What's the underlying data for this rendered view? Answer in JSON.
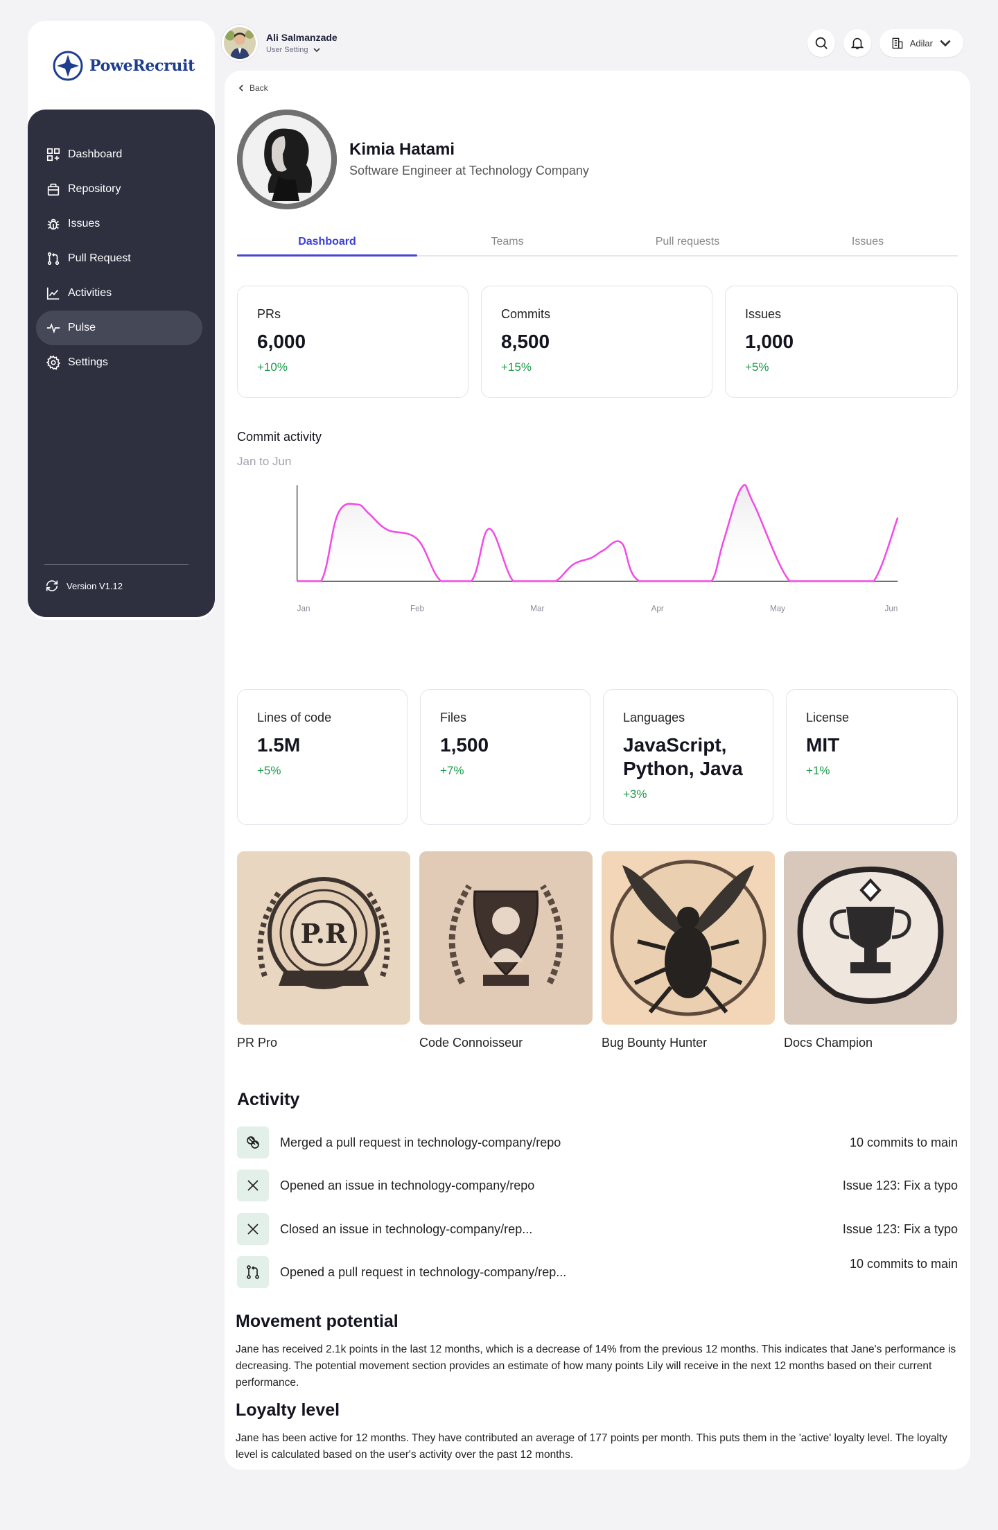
{
  "brand": {
    "name": "PoweRecruit",
    "color": "#1d3d8f"
  },
  "sidebar": {
    "items": [
      {
        "label": "Dashboard",
        "icon": "dashboard-icon"
      },
      {
        "label": "Repository",
        "icon": "repository-icon"
      },
      {
        "label": "Issues",
        "icon": "bug-icon"
      },
      {
        "label": "Pull Request",
        "icon": "pull-request-icon"
      },
      {
        "label": "Activities",
        "icon": "chart-line-icon"
      },
      {
        "label": "Pulse",
        "icon": "pulse-icon",
        "active": true
      },
      {
        "label": "Settings",
        "icon": "gear-icon"
      }
    ],
    "version": "Version V1.12"
  },
  "topbar": {
    "user_name": "Ali Salmanzade",
    "user_setting": "User Setting",
    "company": "Adilar"
  },
  "profile": {
    "back": "Back",
    "name": "Kimia Hatami",
    "role": "Software Engineer at Technology Company"
  },
  "tabs": [
    {
      "label": "Dashboard",
      "active": true
    },
    {
      "label": "Teams"
    },
    {
      "label": "Pull requests"
    },
    {
      "label": "Issues"
    }
  ],
  "stats_top": [
    {
      "label": "PRs",
      "value": "6,000",
      "change": "+10%"
    },
    {
      "label": "Commits",
      "value": "8,500",
      "change": "+15%"
    },
    {
      "label": "Issues",
      "value": "1,000",
      "change": "+5%"
    }
  ],
  "commit_activity": {
    "title": "Commit activity",
    "subtitle": "Jan to Jun"
  },
  "chart_data": {
    "type": "area",
    "title": "Commit activity",
    "subtitle": "Jan to Jun",
    "categories": [
      "Jan",
      "Feb",
      "Mar",
      "Apr",
      "May",
      "Jun"
    ],
    "x": [
      0.0,
      0.2,
      0.34,
      0.5,
      0.6,
      0.75,
      1.0,
      1.2,
      1.45,
      1.6,
      1.8,
      2.0,
      2.15,
      2.3,
      2.45,
      2.55,
      2.7,
      2.85,
      3.3,
      3.45,
      3.55,
      3.7,
      3.8,
      4.1,
      4.35,
      4.5,
      4.6,
      4.8,
      5.0
    ],
    "y": [
      0,
      0,
      72,
      82,
      72,
      55,
      45,
      0,
      0,
      56,
      0,
      0,
      0,
      18,
      25,
      33,
      41,
      0,
      0,
      0,
      43,
      100,
      83,
      0,
      0,
      0,
      0,
      0,
      68
    ],
    "ylim": [
      0,
      100
    ],
    "line_color": "#f24ae6"
  },
  "stats_bottom": [
    {
      "label": "Lines of code",
      "value": "1.5M",
      "change": "+5%"
    },
    {
      "label": "Files",
      "value": "1,500",
      "change": "+7%"
    },
    {
      "label": "Languages",
      "value": "JavaScript, Python, Java",
      "change": "+3%"
    },
    {
      "label": "License",
      "value": "MIT",
      "change": "+1%"
    }
  ],
  "badges": [
    {
      "name": "PR Pro",
      "emblem_text": "P.R"
    },
    {
      "name": "Code Connoisseur"
    },
    {
      "name": "Bug Bounty Hunter"
    },
    {
      "name": "Docs Champion"
    }
  ],
  "activity": {
    "title": "Activity",
    "items": [
      {
        "icon": "merge-icon",
        "text": "Merged a pull request in technology-company/repo",
        "detail": "10 commits to main"
      },
      {
        "icon": "close-icon",
        "text": "Opened an issue in technology-company/repo",
        "detail": "Issue 123: Fix a typo"
      },
      {
        "icon": "close-icon",
        "text": "Closed an issue in technology-company/rep...",
        "detail": "Issue 123: Fix a typo"
      },
      {
        "icon": "pull-request-icon",
        "text": "Opened a pull request in technology-company/rep...",
        "detail": "10 commits to main"
      }
    ]
  },
  "movement": {
    "title": "Movement potential",
    "text": "Jane has received 2.1k points in the last 12 months, which is a decrease of 14% from the previous 12 months. This indicates that Jane's performance is decreasing. The potential movement section provides an estimate of how many points Lily will receive in the next 12 months based on their current performance."
  },
  "loyalty": {
    "title": "Loyalty level",
    "text": "Jane has been active for 12 months. They have contributed an average of 177 points per month. This puts them in the 'active' loyalty level. The loyalty level is calculated based on the user's activity over the past 12 months."
  }
}
